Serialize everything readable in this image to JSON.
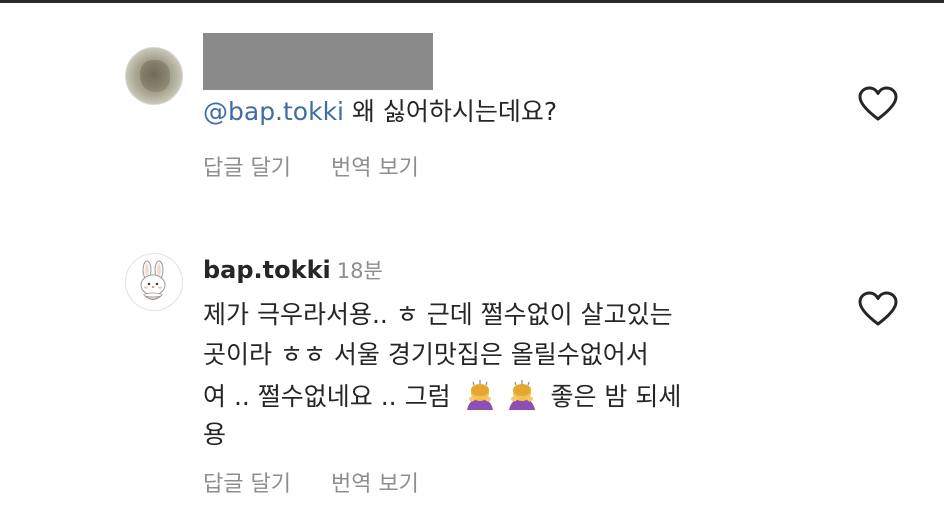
{
  "comments": [
    {
      "mention": "@bap.tokki",
      "text": " 왜 싫어하시는데요?",
      "reply_label": "답글 달기",
      "translate_label": "번역 보기"
    },
    {
      "username": "bap.tokki",
      "time": "18분",
      "lines": [
        "제가 극우라서용.. ㅎ 근데 쩔수없이 살고있는",
        "곳이라 ㅎㅎ 서울 경기맛집은 올릴수없어서",
        "여 .. 쩔수없네요 .. 그럼",
        "좋은 밤 되세",
        "용"
      ],
      "reply_label": "답글 달기",
      "translate_label": "번역 보기"
    }
  ],
  "icons": {
    "like": "heart-outline-icon",
    "emoji": "person-bowing-emoji"
  },
  "colors": {
    "mention": "#3f6ea6",
    "meta": "#8e8e8e",
    "text": "#262626"
  }
}
